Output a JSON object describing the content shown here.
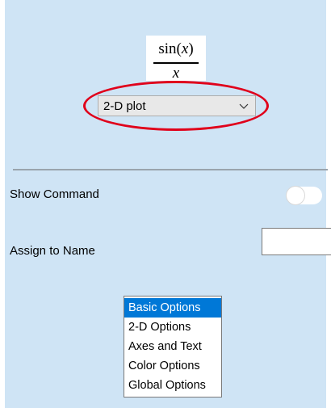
{
  "formula": {
    "numerator_func": "sin",
    "numerator_open": "(",
    "numerator_var": "x",
    "numerator_close": ")",
    "denominator": "x"
  },
  "plot_type": {
    "selected": "2-D plot",
    "icon": "chevron-down-icon"
  },
  "show_command": {
    "label": "Show Command",
    "enabled": false
  },
  "assign_to_name": {
    "label": "Assign to Name",
    "value": ""
  },
  "options_list": {
    "items": [
      "Basic Options",
      "2-D Options",
      "Axes and Text",
      "Color Options",
      "Global Options"
    ],
    "selected_index": 0
  },
  "colors": {
    "panel_background": "#cfe4f5",
    "highlight_ring": "#e0001b",
    "selection": "#0078d7"
  }
}
